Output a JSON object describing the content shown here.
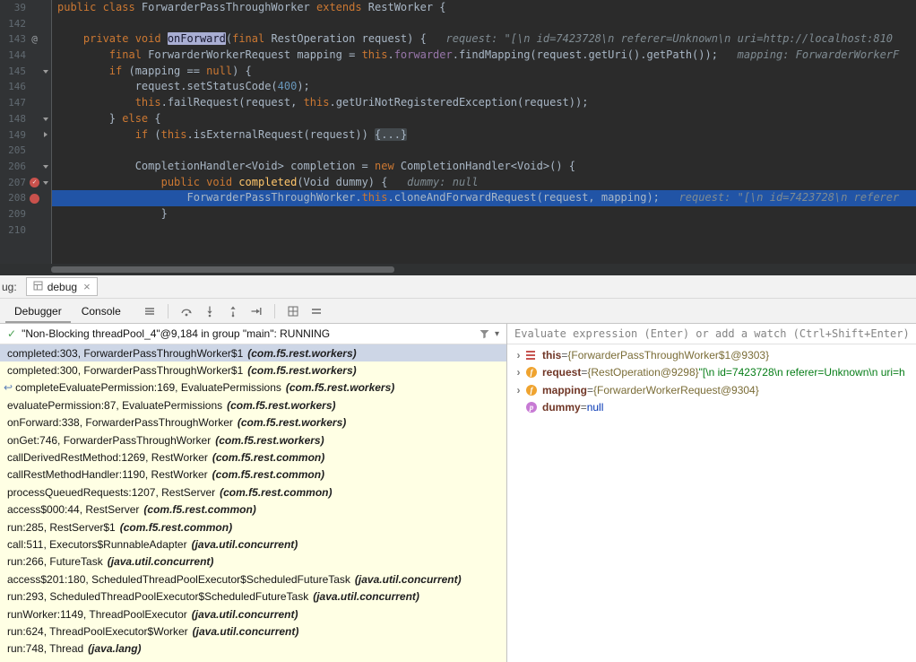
{
  "colors": {
    "execution_line": "#2154a6",
    "breakpoint_red": "#c9514c",
    "library_frame_bg": "#ffffe4",
    "selected_frame_bg": "#cdd6e6",
    "editor_bg": "#2b2b2b"
  },
  "icons": {
    "at_glyph": "@",
    "check_glyph": "✓",
    "close_glyph": "×",
    "return_glyph": "↩",
    "chevron_glyph": "›",
    "dropdown_glyph": "▾"
  },
  "win": {
    "label": "ug:",
    "tab": "debug"
  },
  "toolbar": {
    "debugger_tab": "Debugger",
    "console_tab": "Console"
  },
  "editor": {
    "lines": [
      {
        "n": "39",
        "t": [
          [
            "k",
            "public class "
          ],
          [
            "d",
            "ForwarderPassThroughWorker "
          ],
          [
            "k",
            "extends"
          ],
          [
            "d",
            " RestWorker {"
          ]
        ]
      },
      {
        "n": "142",
        "t": []
      },
      {
        "n": "143",
        "g": "at",
        "t": [
          [
            "k",
            "    private void "
          ],
          [
            "mh",
            "onForward"
          ],
          [
            "d",
            "("
          ],
          [
            "k",
            "final"
          ],
          [
            "d",
            " RestOperation request) {"
          ],
          [
            "h",
            "   request: \"[\\n id=7423728\\n referer=Unknown\\n uri=http://localhost:810"
          ]
        ]
      },
      {
        "n": "144",
        "t": [
          [
            "k",
            "        final"
          ],
          [
            "d",
            " ForwarderWorkerRequest mapping = "
          ],
          [
            "k",
            "this"
          ],
          [
            "d",
            "."
          ],
          [
            "f",
            "forwarder"
          ],
          [
            "d",
            ".findMapping(request.getUri().getPath());"
          ],
          [
            "h",
            "   mapping: ForwarderWorkerF"
          ]
        ]
      },
      {
        "n": "145",
        "fold": "v",
        "t": [
          [
            "k",
            "        if"
          ],
          [
            "d",
            " (mapping == "
          ],
          [
            "k",
            "null"
          ],
          [
            "d",
            ") {"
          ]
        ]
      },
      {
        "n": "146",
        "t": [
          [
            "d",
            "            request.setStatusCode("
          ],
          [
            "n2",
            "400"
          ],
          [
            "d",
            ");"
          ]
        ]
      },
      {
        "n": "147",
        "t": [
          [
            "d",
            "            "
          ],
          [
            "k",
            "this"
          ],
          [
            "d",
            ".failRequest(request, "
          ],
          [
            "k",
            "this"
          ],
          [
            "d",
            ".getUriNotRegisteredException(request));"
          ]
        ]
      },
      {
        "n": "148",
        "fold": "v",
        "t": [
          [
            "d",
            "        } "
          ],
          [
            "k",
            "else"
          ],
          [
            "d",
            " {"
          ]
        ]
      },
      {
        "n": "149",
        "fold": "r",
        "t": [
          [
            "k",
            "            if"
          ],
          [
            "d",
            " ("
          ],
          [
            "k",
            "this"
          ],
          [
            "d",
            ".isExternalRequest(request)) "
          ],
          [
            "fd",
            "{...}"
          ]
        ]
      },
      {
        "n": "205",
        "t": []
      },
      {
        "n": "206",
        "fold": "v",
        "t": [
          [
            "d",
            "            CompletionHandler<Void> completion = "
          ],
          [
            "k",
            "new"
          ],
          [
            "d",
            " CompletionHandler<Void>() {"
          ]
        ]
      },
      {
        "n": "207",
        "g": "bpc",
        "fold": "v",
        "t": [
          [
            "k",
            "                public void "
          ],
          [
            "m",
            "completed"
          ],
          [
            "d",
            "(Void dummy) {"
          ],
          [
            "h",
            "   dummy: null"
          ]
        ]
      },
      {
        "n": "208",
        "g": "bp",
        "exec": true,
        "t": [
          [
            "d",
            "                    ForwarderPassThroughWorker."
          ],
          [
            "k",
            "this"
          ],
          [
            "d",
            ".cloneAndForwardRequest(request, mapping);"
          ],
          [
            "h",
            "   request: \"[\\n id=7423728\\n referer"
          ]
        ]
      },
      {
        "n": "209",
        "t": [
          [
            "d",
            "                }"
          ]
        ]
      },
      {
        "n": "210",
        "t": []
      }
    ]
  },
  "frames": {
    "thread": "\"Non-Blocking threadPool_4\"@9,184 in group \"main\": RUNNING",
    "rows": [
      {
        "text": "completed:303, ForwarderPassThroughWorker$1",
        "pkg": "(com.f5.rest.workers)",
        "selected": true
      },
      {
        "text": "completed:300, ForwarderPassThroughWorker$1",
        "pkg": "(com.f5.rest.workers)"
      },
      {
        "text": "completeEvaluatePermission:169, EvaluatePermissions",
        "pkg": "(com.f5.rest.workers)",
        "ret": true
      },
      {
        "text": "evaluatePermission:87, EvaluatePermissions",
        "pkg": "(com.f5.rest.workers)"
      },
      {
        "text": "onForward:338, ForwarderPassThroughWorker",
        "pkg": "(com.f5.rest.workers)"
      },
      {
        "text": "onGet:746, ForwarderPassThroughWorker",
        "pkg": "(com.f5.rest.workers)"
      },
      {
        "text": "callDerivedRestMethod:1269, RestWorker",
        "pkg": "(com.f5.rest.common)"
      },
      {
        "text": "callRestMethodHandler:1190, RestWorker",
        "pkg": "(com.f5.rest.common)"
      },
      {
        "text": "processQueuedRequests:1207, RestServer",
        "pkg": "(com.f5.rest.common)"
      },
      {
        "text": "access$000:44, RestServer",
        "pkg": "(com.f5.rest.common)"
      },
      {
        "text": "run:285, RestServer$1",
        "pkg": "(com.f5.rest.common)"
      },
      {
        "text": "call:511, Executors$RunnableAdapter",
        "pkg": "(java.util.concurrent)"
      },
      {
        "text": "run:266, FutureTask",
        "pkg": "(java.util.concurrent)"
      },
      {
        "text": "access$201:180, ScheduledThreadPoolExecutor$ScheduledFutureTask",
        "pkg": "(java.util.concurrent)"
      },
      {
        "text": "run:293, ScheduledThreadPoolExecutor$ScheduledFutureTask",
        "pkg": "(java.util.concurrent)"
      },
      {
        "text": "runWorker:1149, ThreadPoolExecutor",
        "pkg": "(java.util.concurrent)"
      },
      {
        "text": "run:624, ThreadPoolExecutor$Worker",
        "pkg": "(java.util.concurrent)"
      },
      {
        "text": "run:748, Thread",
        "pkg": "(java.lang)"
      }
    ]
  },
  "variables": {
    "placeholder": "Evaluate expression (Enter) or add a watch (Ctrl+Shift+Enter)",
    "rows": [
      {
        "expand": true,
        "icon": "this",
        "name": "this",
        "value": [
          [
            "eq",
            " = "
          ],
          [
            "ref",
            "{ForwarderPassThroughWorker$1@9303}"
          ]
        ]
      },
      {
        "expand": true,
        "icon": "field",
        "name": "request",
        "value": [
          [
            "eq",
            " = "
          ],
          [
            "ref",
            "{RestOperation@9298} "
          ],
          [
            "str",
            "\"[\\n id=7423728\\n referer=Unknown\\n uri=h"
          ]
        ]
      },
      {
        "expand": true,
        "icon": "field",
        "name": "mapping",
        "value": [
          [
            "eq",
            " = "
          ],
          [
            "ref",
            "{ForwarderWorkerRequest@9304}"
          ]
        ]
      },
      {
        "expand": false,
        "icon": "param",
        "name": "dummy",
        "value": [
          [
            "eq",
            " = "
          ],
          [
            "kw",
            "null"
          ]
        ]
      }
    ]
  }
}
